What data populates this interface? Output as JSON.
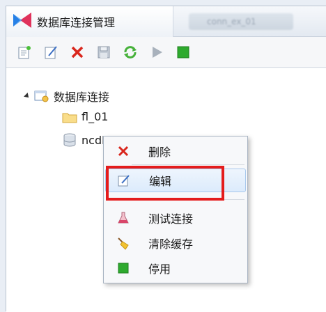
{
  "window": {
    "title": "数据库连接管理",
    "blurred_tab_label": "conn_ex_01"
  },
  "toolbar": {
    "buttons": [
      {
        "name": "new-connection",
        "icon": "new-document-icon"
      },
      {
        "name": "edit",
        "icon": "edit-icon"
      },
      {
        "name": "delete",
        "icon": "red-x-icon"
      },
      {
        "name": "save",
        "icon": "save-icon"
      },
      {
        "name": "refresh",
        "icon": "refresh-icon"
      },
      {
        "name": "run",
        "icon": "play-icon"
      },
      {
        "name": "stop",
        "icon": "green-square-icon"
      }
    ]
  },
  "tree": {
    "root": {
      "label": "数据库连接",
      "expanded": true
    },
    "children": [
      {
        "label": "fl_01",
        "icon": "folder-icon"
      },
      {
        "label": "ncdb",
        "icon": "database-icon"
      }
    ]
  },
  "context_menu": {
    "items": [
      {
        "label": "删除",
        "icon": "delete-x-icon"
      },
      {
        "label": "编辑",
        "icon": "edit-icon",
        "hovered": true
      },
      {
        "label": "测试连接",
        "icon": "flask-icon"
      },
      {
        "label": "清除缓存",
        "icon": "broom-icon"
      },
      {
        "label": "停用",
        "icon": "green-square-icon"
      }
    ]
  },
  "colors": {
    "highlight_border": "#e41c1c",
    "delete_red": "#d9261c",
    "stop_green": "#2eaa2e"
  }
}
